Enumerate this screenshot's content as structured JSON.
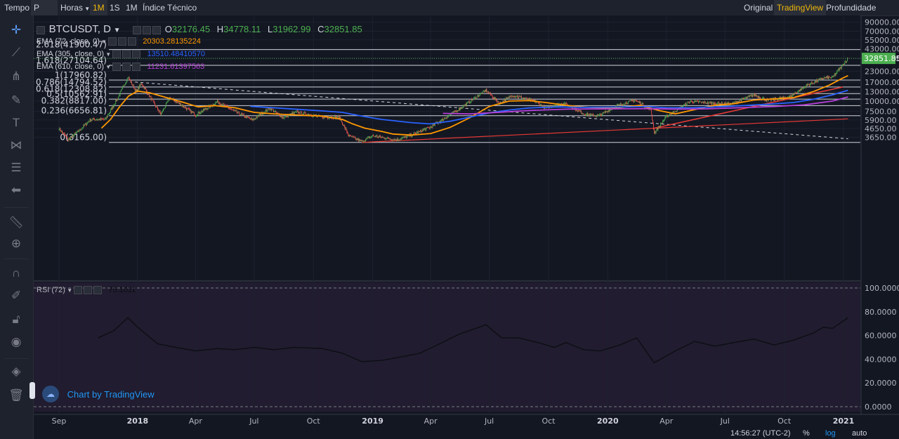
{
  "topbar": {
    "tempo": "Tempo",
    "interval_select": "P",
    "horas": "Horas",
    "interval_1m": "1M",
    "interval_1s": "1S",
    "interval_1m_b": "1M",
    "indicators": "Índice Técnico",
    "view_original": "Original",
    "view_tradingview": "TradingView",
    "view_depth": "Profundidade"
  },
  "legend": {
    "symbol": "BTCUSDT, D",
    "open_label": "O",
    "open": "32176.45",
    "high_label": "H",
    "high": "34778.11",
    "low_label": "L",
    "low": "31962.99",
    "close_label": "C",
    "close": "32851.85",
    "ema72_label": "EMA (72, close, 0)",
    "ema72_value": "20303.28135224",
    "ema305_label": "EMA (305, close, 0)",
    "ema305_value": "13510.48410570",
    "ema610_label": "EMA (610, close, 0)",
    "ema610_value": "11231.61397563",
    "rsi_label": "RSI (72)",
    "rsi_value": "75.1011"
  },
  "watermark": "Chart by TradingView",
  "bottom": {
    "time": "14:56:27 (UTC-2)",
    "percent": "%",
    "log": "log",
    "auto": "auto"
  },
  "colors": {
    "background": "#131722",
    "candle_up": "#4caf50",
    "candle_down": "#ef5350",
    "ema72": "#ff9800",
    "ema305": "#2962ff",
    "ema610": "#b53fd8",
    "trendline": "#e53935",
    "fib": "#d1d4dc",
    "last_price": "#4caf50",
    "rsi_line": "#0b0d12"
  },
  "icons": [
    "crosshair-icon",
    "trendline-icon",
    "pitchfork-icon",
    "brush-icon",
    "text-icon",
    "pattern-icon",
    "fib-icon",
    "arrow-icon",
    "ruler-icon",
    "zoom-icon",
    "magnet-icon",
    "lock-draw-icon",
    "lock-icon",
    "eye-icon",
    "layers-icon",
    "trash-icon"
  ],
  "chart_data": [
    {
      "type": "candlestick",
      "title": "BTCUSDT, D",
      "y_scale": "log",
      "y_ticks": [
        "90000.00",
        "70000.00",
        "55000.00",
        "43000.00",
        "33000.00",
        "23000.00",
        "17000.00",
        "13000.00",
        "10000.00",
        "7500.00",
        "5900.00",
        "4650.00",
        "3650.00"
      ],
      "x_ticks": [
        "Sep",
        "2018",
        "Apr",
        "Jul",
        "Oct",
        "2019",
        "Apr",
        "Jul",
        "Oct",
        "2020",
        "Apr",
        "Jul",
        "Oct",
        "2021"
      ],
      "last_price_label": "32851.85",
      "fib_levels": [
        {
          "ratio": "2.618",
          "label": "2.618(41900.47)",
          "value": 41900.47
        },
        {
          "ratio": "1.618",
          "label": "1.618(27104.64)",
          "value": 27104.64
        },
        {
          "ratio": "1",
          "label": "1(17960.82)",
          "value": 17960.82
        },
        {
          "ratio": "0.786",
          "label": "0.786(14794.52)",
          "value": 14794.52
        },
        {
          "ratio": "0.618",
          "label": "0.618(12308.82)",
          "value": 12308.82
        },
        {
          "ratio": "0.5",
          "label": "0.5(10562.91)",
          "value": 10562.91
        },
        {
          "ratio": "0.382",
          "label": "0.382(8817.00)",
          "value": 8817.0
        },
        {
          "ratio": "0.236",
          "label": "0.236(6656.81)",
          "value": 6656.81
        },
        {
          "ratio": "0",
          "label": "0(3165.00)",
          "value": 3165.0
        }
      ],
      "series": [
        {
          "name": "EMA (72, close, 0)",
          "color": "#ff9800",
          "points": [
            [
              "2017-11-06",
              4700
            ],
            [
              "2017-11-20",
              6000
            ],
            [
              "2017-12-04",
              8500
            ],
            [
              "2017-12-18",
              11500
            ],
            [
              "2018-01-01",
              13200
            ],
            [
              "2018-01-20",
              12600
            ],
            [
              "2018-02-15",
              11000
            ],
            [
              "2018-03-10",
              9800
            ],
            [
              "2018-04-05",
              8500
            ],
            [
              "2018-05-01",
              8800
            ],
            [
              "2018-06-01",
              8300
            ],
            [
              "2018-07-01",
              7300
            ],
            [
              "2018-08-01",
              7000
            ],
            [
              "2018-09-01",
              6800
            ],
            [
              "2018-10-15",
              6600
            ],
            [
              "2018-11-15",
              6000
            ],
            [
              "2018-12-01",
              5300
            ],
            [
              "2018-12-20",
              4700
            ],
            [
              "2019-01-15",
              4300
            ],
            [
              "2019-02-01",
              4000
            ],
            [
              "2019-03-01",
              3880
            ],
            [
              "2019-04-01",
              4050
            ],
            [
              "2019-05-01",
              4800
            ],
            [
              "2019-06-01",
              6300
            ],
            [
              "2019-07-01",
              8600
            ],
            [
              "2019-08-01",
              10000
            ],
            [
              "2019-09-01",
              10150
            ],
            [
              "2019-10-01",
              9500
            ],
            [
              "2019-11-01",
              8800
            ],
            [
              "2019-12-01",
              8400
            ],
            [
              "2020-01-10",
              8200
            ],
            [
              "2020-02-20",
              8900
            ],
            [
              "2020-03-20",
              7700
            ],
            [
              "2020-04-15",
              7000
            ],
            [
              "2020-05-15",
              7900
            ],
            [
              "2020-06-15",
              8900
            ],
            [
              "2020-07-15",
              9300
            ],
            [
              "2020-08-15",
              10300
            ],
            [
              "2020-09-15",
              10600
            ],
            [
              "2020-10-15",
              11000
            ],
            [
              "2020-11-15",
              13000
            ],
            [
              "2020-12-10",
              15600
            ],
            [
              "2020-12-31",
              19000
            ],
            [
              "2021-01-08",
              20303
            ]
          ]
        },
        {
          "name": "EMA (305, close, 0)",
          "color": "#2962ff",
          "points": [
            [
              "2018-06-25",
              8650
            ],
            [
              "2018-07-20",
              8400
            ],
            [
              "2018-09-01",
              8000
            ],
            [
              "2018-10-15",
              7600
            ],
            [
              "2018-11-15",
              7300
            ],
            [
              "2018-12-15",
              6600
            ],
            [
              "2019-01-15",
              6000
            ],
            [
              "2019-03-01",
              5500
            ],
            [
              "2019-03-31",
              5300
            ],
            [
              "2019-05-01",
              5700
            ],
            [
              "2019-06-01",
              6400
            ],
            [
              "2019-07-01",
              7200
            ],
            [
              "2019-08-01",
              7800
            ],
            [
              "2019-09-01",
              8250
            ],
            [
              "2019-10-15",
              8500
            ],
            [
              "2019-12-01",
              8400
            ],
            [
              "2020-01-15",
              8450
            ],
            [
              "2020-03-01",
              8600
            ],
            [
              "2020-04-01",
              8300
            ],
            [
              "2020-05-15",
              8300
            ],
            [
              "2020-07-01",
              8600
            ],
            [
              "2020-09-01",
              9100
            ],
            [
              "2020-10-15",
              9600
            ],
            [
              "2020-11-15",
              10500
            ],
            [
              "2020-12-15",
              11900
            ],
            [
              "2021-01-08",
              13510
            ]
          ]
        },
        {
          "name": "EMA (610, close, 0)",
          "color": "#b53fd8",
          "points": [
            [
              "2019-04-20",
              7100
            ],
            [
              "2019-06-01",
              7000
            ],
            [
              "2019-07-15",
              7300
            ],
            [
              "2019-09-01",
              7700
            ],
            [
              "2019-11-01",
              8000
            ],
            [
              "2020-01-01",
              8050
            ],
            [
              "2020-03-01",
              8100
            ],
            [
              "2020-04-15",
              8000
            ],
            [
              "2020-06-01",
              8050
            ],
            [
              "2020-08-01",
              8350
            ],
            [
              "2020-09-15",
              8600
            ],
            [
              "2020-11-01",
              9000
            ],
            [
              "2020-12-15",
              10000
            ],
            [
              "2021-01-08",
              11231
            ]
          ]
        }
      ]
    },
    {
      "type": "line",
      "title": "RSI (72)",
      "y_ticks": [
        "100.0000",
        "80.0000",
        "60.0000",
        "40.0000",
        "20.0000",
        "0.0000"
      ],
      "ylim": [
        0,
        100
      ],
      "series": [
        {
          "name": "RSI (72)",
          "points": [
            [
              "2017-11-01",
              58
            ],
            [
              "2017-11-25",
              64
            ],
            [
              "2017-12-17",
              75
            ],
            [
              "2018-01-01",
              67
            ],
            [
              "2018-02-01",
              53
            ],
            [
              "2018-03-01",
              50
            ],
            [
              "2018-04-01",
              47
            ],
            [
              "2018-05-05",
              49
            ],
            [
              "2018-06-01",
              48
            ],
            [
              "2018-07-01",
              50
            ],
            [
              "2018-08-01",
              48
            ],
            [
              "2018-09-01",
              50
            ],
            [
              "2018-10-15",
              49
            ],
            [
              "2018-11-15",
              45
            ],
            [
              "2018-12-15",
              38
            ],
            [
              "2019-01-15",
              39
            ],
            [
              "2019-02-15",
              42
            ],
            [
              "2019-03-15",
              45
            ],
            [
              "2019-04-15",
              53
            ],
            [
              "2019-05-15",
              61
            ],
            [
              "2019-06-26",
              69
            ],
            [
              "2019-07-20",
              58
            ],
            [
              "2019-08-15",
              58
            ],
            [
              "2019-09-15",
              54
            ],
            [
              "2019-10-10",
              50
            ],
            [
              "2019-10-28",
              54
            ],
            [
              "2019-11-25",
              48
            ],
            [
              "2019-12-20",
              47
            ],
            [
              "2020-01-20",
              52
            ],
            [
              "2020-02-15",
              58
            ],
            [
              "2020-03-13",
              37
            ],
            [
              "2020-04-15",
              47
            ],
            [
              "2020-05-15",
              55
            ],
            [
              "2020-06-15",
              51
            ],
            [
              "2020-07-15",
              54
            ],
            [
              "2020-08-15",
              57
            ],
            [
              "2020-09-15",
              52
            ],
            [
              "2020-10-15",
              56
            ],
            [
              "2020-11-15",
              62
            ],
            [
              "2020-12-01",
              67
            ],
            [
              "2020-12-15",
              66
            ],
            [
              "2021-01-08",
              75
            ]
          ]
        }
      ]
    }
  ]
}
